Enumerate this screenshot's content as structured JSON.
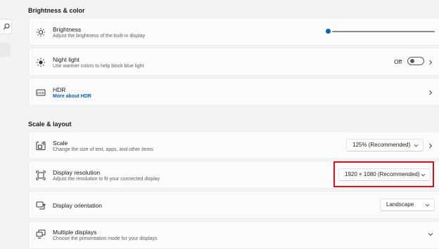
{
  "nav": {
    "search_icon": "search-icon"
  },
  "brightness_color": {
    "section_title": "Brightness & color",
    "brightness": {
      "title": "Brightness",
      "subtitle": "Adjust the brightness of the built-in display",
      "icon": "sun-icon",
      "level": 0.0
    },
    "night_light": {
      "title": "Night light",
      "subtitle": "Use warmer colors to help block blue light",
      "icon": "night-light-icon",
      "state_label": "Off",
      "enabled": false
    },
    "hdr": {
      "title": "HDR",
      "link": "More about HDR",
      "icon": "hdr-icon"
    }
  },
  "scale_layout": {
    "section_title": "Scale & layout",
    "scale": {
      "title": "Scale",
      "subtitle": "Change the size of text, apps, and other items",
      "icon": "scale-icon",
      "value": "125% (Recommended)"
    },
    "display_resolution": {
      "title": "Display resolution",
      "subtitle": "Adjust the resolution to fit your connected display",
      "icon": "resolution-icon",
      "value": "1920 × 1080 (Recommended)",
      "highlighted": true,
      "highlight_color": "#e0101a"
    },
    "display_orientation": {
      "title": "Display orientation",
      "icon": "orientation-icon",
      "value": "Landscape"
    },
    "multiple_displays": {
      "title": "Multiple displays",
      "subtitle": "Choose the presentation mode for your displays",
      "icon": "multiple-displays-icon"
    }
  },
  "colors": {
    "accent": "#0067c0",
    "link": "#0a5cb8",
    "background": "#f3f3f3",
    "card": "#fbfbfb"
  }
}
